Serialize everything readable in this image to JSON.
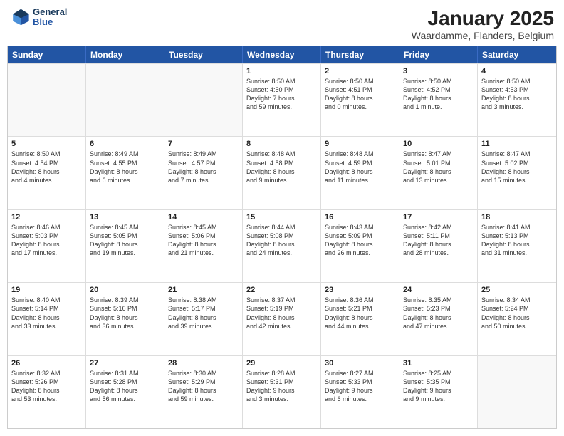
{
  "logo": {
    "text_general": "General",
    "text_blue": "Blue"
  },
  "header": {
    "title": "January 2025",
    "subtitle": "Waardamme, Flanders, Belgium"
  },
  "weekdays": [
    "Sunday",
    "Monday",
    "Tuesday",
    "Wednesday",
    "Thursday",
    "Friday",
    "Saturday"
  ],
  "weeks": [
    [
      {
        "day": "",
        "empty": true
      },
      {
        "day": "",
        "empty": true
      },
      {
        "day": "",
        "empty": true
      },
      {
        "day": "1",
        "sunrise": "Sunrise: 8:50 AM",
        "sunset": "Sunset: 4:50 PM",
        "daylight": "Daylight: 7 hours and 59 minutes."
      },
      {
        "day": "2",
        "sunrise": "Sunrise: 8:50 AM",
        "sunset": "Sunset: 4:51 PM",
        "daylight": "Daylight: 8 hours and 0 minutes."
      },
      {
        "day": "3",
        "sunrise": "Sunrise: 8:50 AM",
        "sunset": "Sunset: 4:52 PM",
        "daylight": "Daylight: 8 hours and 1 minute."
      },
      {
        "day": "4",
        "sunrise": "Sunrise: 8:50 AM",
        "sunset": "Sunset: 4:53 PM",
        "daylight": "Daylight: 8 hours and 3 minutes."
      }
    ],
    [
      {
        "day": "5",
        "sunrise": "Sunrise: 8:50 AM",
        "sunset": "Sunset: 4:54 PM",
        "daylight": "Daylight: 8 hours and 4 minutes."
      },
      {
        "day": "6",
        "sunrise": "Sunrise: 8:49 AM",
        "sunset": "Sunset: 4:55 PM",
        "daylight": "Daylight: 8 hours and 6 minutes."
      },
      {
        "day": "7",
        "sunrise": "Sunrise: 8:49 AM",
        "sunset": "Sunset: 4:57 PM",
        "daylight": "Daylight: 8 hours and 7 minutes."
      },
      {
        "day": "8",
        "sunrise": "Sunrise: 8:48 AM",
        "sunset": "Sunset: 4:58 PM",
        "daylight": "Daylight: 8 hours and 9 minutes."
      },
      {
        "day": "9",
        "sunrise": "Sunrise: 8:48 AM",
        "sunset": "Sunset: 4:59 PM",
        "daylight": "Daylight: 8 hours and 11 minutes."
      },
      {
        "day": "10",
        "sunrise": "Sunrise: 8:47 AM",
        "sunset": "Sunset: 5:01 PM",
        "daylight": "Daylight: 8 hours and 13 minutes."
      },
      {
        "day": "11",
        "sunrise": "Sunrise: 8:47 AM",
        "sunset": "Sunset: 5:02 PM",
        "daylight": "Daylight: 8 hours and 15 minutes."
      }
    ],
    [
      {
        "day": "12",
        "sunrise": "Sunrise: 8:46 AM",
        "sunset": "Sunset: 5:03 PM",
        "daylight": "Daylight: 8 hours and 17 minutes."
      },
      {
        "day": "13",
        "sunrise": "Sunrise: 8:45 AM",
        "sunset": "Sunset: 5:05 PM",
        "daylight": "Daylight: 8 hours and 19 minutes."
      },
      {
        "day": "14",
        "sunrise": "Sunrise: 8:45 AM",
        "sunset": "Sunset: 5:06 PM",
        "daylight": "Daylight: 8 hours and 21 minutes."
      },
      {
        "day": "15",
        "sunrise": "Sunrise: 8:44 AM",
        "sunset": "Sunset: 5:08 PM",
        "daylight": "Daylight: 8 hours and 24 minutes."
      },
      {
        "day": "16",
        "sunrise": "Sunrise: 8:43 AM",
        "sunset": "Sunset: 5:09 PM",
        "daylight": "Daylight: 8 hours and 26 minutes."
      },
      {
        "day": "17",
        "sunrise": "Sunrise: 8:42 AM",
        "sunset": "Sunset: 5:11 PM",
        "daylight": "Daylight: 8 hours and 28 minutes."
      },
      {
        "day": "18",
        "sunrise": "Sunrise: 8:41 AM",
        "sunset": "Sunset: 5:13 PM",
        "daylight": "Daylight: 8 hours and 31 minutes."
      }
    ],
    [
      {
        "day": "19",
        "sunrise": "Sunrise: 8:40 AM",
        "sunset": "Sunset: 5:14 PM",
        "daylight": "Daylight: 8 hours and 33 minutes."
      },
      {
        "day": "20",
        "sunrise": "Sunrise: 8:39 AM",
        "sunset": "Sunset: 5:16 PM",
        "daylight": "Daylight: 8 hours and 36 minutes."
      },
      {
        "day": "21",
        "sunrise": "Sunrise: 8:38 AM",
        "sunset": "Sunset: 5:17 PM",
        "daylight": "Daylight: 8 hours and 39 minutes."
      },
      {
        "day": "22",
        "sunrise": "Sunrise: 8:37 AM",
        "sunset": "Sunset: 5:19 PM",
        "daylight": "Daylight: 8 hours and 42 minutes."
      },
      {
        "day": "23",
        "sunrise": "Sunrise: 8:36 AM",
        "sunset": "Sunset: 5:21 PM",
        "daylight": "Daylight: 8 hours and 44 minutes."
      },
      {
        "day": "24",
        "sunrise": "Sunrise: 8:35 AM",
        "sunset": "Sunset: 5:23 PM",
        "daylight": "Daylight: 8 hours and 47 minutes."
      },
      {
        "day": "25",
        "sunrise": "Sunrise: 8:34 AM",
        "sunset": "Sunset: 5:24 PM",
        "daylight": "Daylight: 8 hours and 50 minutes."
      }
    ],
    [
      {
        "day": "26",
        "sunrise": "Sunrise: 8:32 AM",
        "sunset": "Sunset: 5:26 PM",
        "daylight": "Daylight: 8 hours and 53 minutes."
      },
      {
        "day": "27",
        "sunrise": "Sunrise: 8:31 AM",
        "sunset": "Sunset: 5:28 PM",
        "daylight": "Daylight: 8 hours and 56 minutes."
      },
      {
        "day": "28",
        "sunrise": "Sunrise: 8:30 AM",
        "sunset": "Sunset: 5:29 PM",
        "daylight": "Daylight: 8 hours and 59 minutes."
      },
      {
        "day": "29",
        "sunrise": "Sunrise: 8:28 AM",
        "sunset": "Sunset: 5:31 PM",
        "daylight": "Daylight: 9 hours and 3 minutes."
      },
      {
        "day": "30",
        "sunrise": "Sunrise: 8:27 AM",
        "sunset": "Sunset: 5:33 PM",
        "daylight": "Daylight: 9 hours and 6 minutes."
      },
      {
        "day": "31",
        "sunrise": "Sunrise: 8:25 AM",
        "sunset": "Sunset: 5:35 PM",
        "daylight": "Daylight: 9 hours and 9 minutes."
      },
      {
        "day": "",
        "empty": true
      }
    ]
  ]
}
